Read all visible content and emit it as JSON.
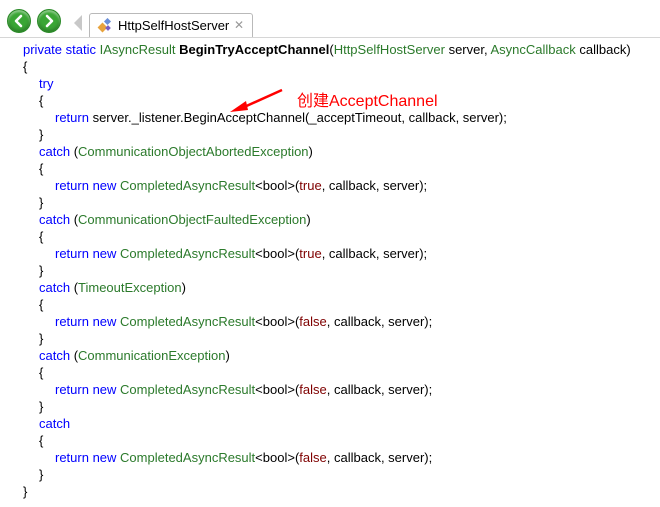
{
  "tab": {
    "title": "HttpSelfHostServer",
    "close": "✕"
  },
  "annotation": {
    "text": "创建AcceptChannel",
    "color": "#ff0000"
  },
  "colors": {
    "keyword": "#0000ff",
    "type": "#2b7a2b",
    "literal": "#7f0000"
  },
  "code": {
    "l1": {
      "kw1": "private static ",
      "t1": "IAsyncResult ",
      "name": "BeginTryAcceptChannel",
      "open": "(",
      "t2": "HttpSelfHostServer",
      "p1": " server, ",
      "t3": "AsyncCallback",
      "p2": " callback)"
    },
    "l2": "{",
    "l3": "try",
    "l4": "{",
    "l5": {
      "kw": "return ",
      "a": "server._listener.",
      "b": "BeginAcceptChannel(_acceptTimeout, callback, server);"
    },
    "l6": "}",
    "l7": {
      "kw": "catch ",
      "open": "(",
      "t": "CommunicationObjectAbortedException",
      "close": ")"
    },
    "l8": "{",
    "l9": {
      "kw": "return new ",
      "t": "CompletedAsyncResult",
      "g": "<bool>",
      "open": "(",
      "lit": "true",
      "rest": ", callback, server);"
    },
    "l10": "}",
    "l11": {
      "kw": "catch ",
      "open": "(",
      "t": "CommunicationObjectFaultedException",
      "close": ")"
    },
    "l12": "{",
    "l13": {
      "kw": "return new ",
      "t": "CompletedAsyncResult",
      "g": "<bool>",
      "open": "(",
      "lit": "true",
      "rest": ", callback, server);"
    },
    "l14": "}",
    "l15": {
      "kw": "catch ",
      "open": "(",
      "t": "TimeoutException",
      "close": ")"
    },
    "l16": "{",
    "l17": {
      "kw": "return new ",
      "t": "CompletedAsyncResult",
      "g": "<bool>",
      "open": "(",
      "lit": "false",
      "rest": ", callback, server);"
    },
    "l18": "}",
    "l19": {
      "kw": "catch ",
      "open": "(",
      "t": "CommunicationException",
      "close": ")"
    },
    "l20": "{",
    "l21": {
      "kw": "return new ",
      "t": "CompletedAsyncResult",
      "g": "<bool>",
      "open": "(",
      "lit": "false",
      "rest": ", callback, server);"
    },
    "l22": "}",
    "l23": "catch",
    "l24": "{",
    "l25": {
      "kw": "return new ",
      "t": "CompletedAsyncResult",
      "g": "<bool>",
      "open": "(",
      "lit": "false",
      "rest": ", callback, server);"
    },
    "l26": "}",
    "l27": "}"
  }
}
